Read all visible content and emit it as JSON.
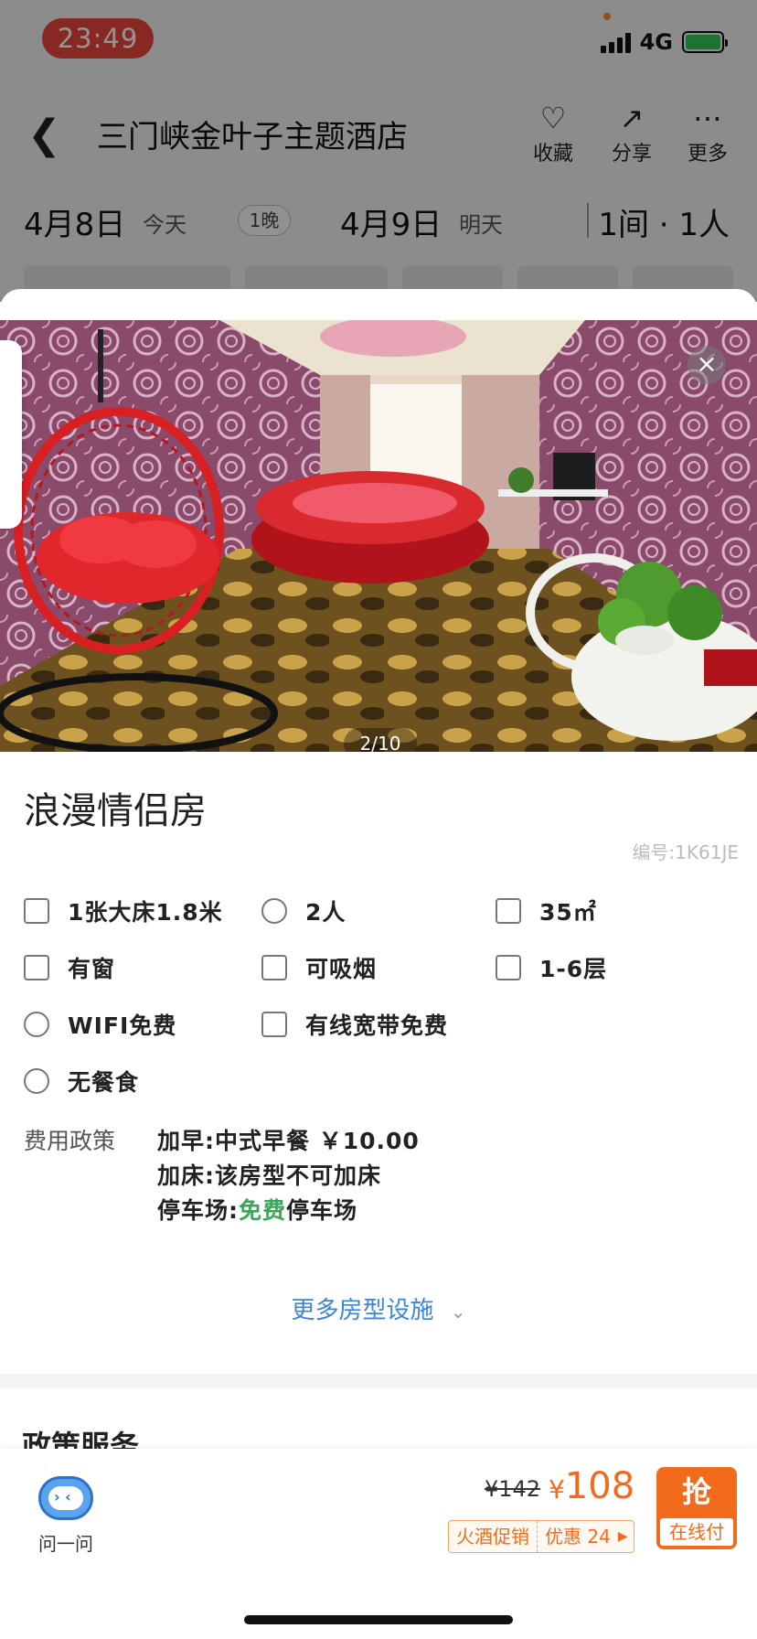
{
  "status_bar": {
    "time": "23:49",
    "network": "4G"
  },
  "header": {
    "hotel_name": "三门峡金叶子主题酒店",
    "actions": [
      {
        "label": "收藏",
        "icon": "heart-plus-icon"
      },
      {
        "label": "分享",
        "icon": "share-icon"
      },
      {
        "label": "更多",
        "icon": "more-icon"
      }
    ]
  },
  "dates": {
    "checkin": "4月8日",
    "checkin_note": "今天",
    "nights": "1晚",
    "checkout": "4月9日",
    "checkout_note": "明天",
    "rooms_guests": "1间 · 1人"
  },
  "gallery": {
    "counter": "2/10",
    "close": "×"
  },
  "room": {
    "title": "浪漫情侣房",
    "code": "编号:1K61JE",
    "facilities": [
      {
        "icon": "bed-icon",
        "text": "1张大床1.8米"
      },
      {
        "icon": "people-icon",
        "text": "2人"
      },
      {
        "icon": "area-icon",
        "text": "35㎡"
      },
      {
        "icon": "window-icon",
        "text": "有窗"
      },
      {
        "icon": "smoking-icon",
        "text": "可吸烟"
      },
      {
        "icon": "floor-icon",
        "text": "1-6层"
      },
      {
        "icon": "wifi-icon",
        "text": "WIFI免费"
      },
      {
        "icon": "cable-icon",
        "text": "有线宽带免费"
      },
      {
        "icon": "meal-icon",
        "text": "无餐食"
      }
    ],
    "policy": {
      "label": "费用政策",
      "breakfast": "加早:中式早餐 ￥10.00",
      "extra_bed": "加床:该房型不可加床",
      "parking_prefix": "停车场:",
      "parking_free": "免费",
      "parking_suffix": "停车场"
    },
    "more_link": "更多房型设施",
    "next_section": "政策服务"
  },
  "bottom": {
    "ask_label": "问一问",
    "price_old": "¥142",
    "price_yen": "¥",
    "price_current": "108",
    "promo_tag": "火酒促销",
    "promo_discount": "优惠 24",
    "grab_label": "抢",
    "grab_sub": "在线付"
  },
  "colors": {
    "accent_orange": "#f26b1d",
    "link_blue": "#3b86d8",
    "free_green": "#3aa65a",
    "time_pill": "#e8453c"
  }
}
